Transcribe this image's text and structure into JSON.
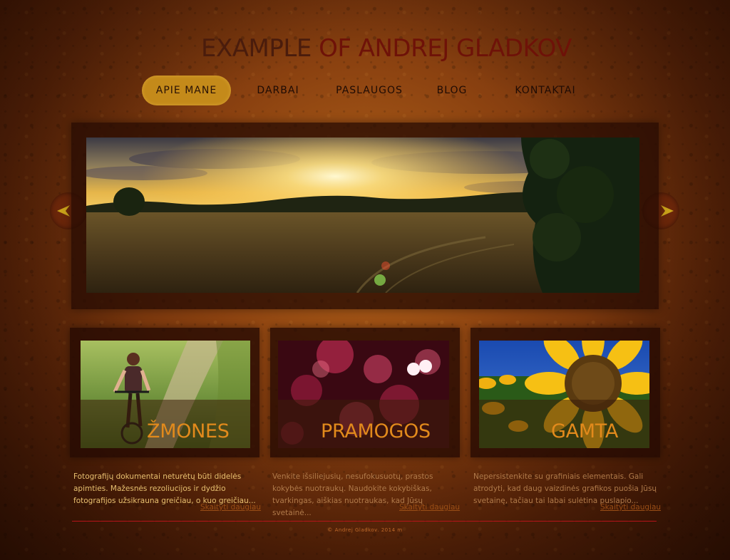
{
  "header": {
    "title_part1": "EXAMPLE",
    "title_part2": "OF ANDREJ GLADKOV"
  },
  "nav": {
    "items": [
      {
        "label": "APIE MANE",
        "active": true
      },
      {
        "label": "DARBAI",
        "active": false
      },
      {
        "label": "PASLAUGOS",
        "active": false
      },
      {
        "label": "BLOG",
        "active": false
      },
      {
        "label": "KONTAKTAI",
        "active": false
      }
    ]
  },
  "slider": {
    "image": "sunset-over-field-photo",
    "prev_icon": "chevron-left-icon",
    "next_icon": "chevron-right-icon"
  },
  "cards": [
    {
      "label": "ŽMONES",
      "image": "woman-on-bicycle-photo",
      "text": "Fotografijų dokumentai neturėtų būti didelės apimties. Mažesnės rezoliucijos ir dydžio fotografijos užsikrauna greičiau, o kuo greičiau...",
      "read_more": "Skaityti daugiau"
    },
    {
      "label": "PRAMOGOS",
      "image": "bokeh-lights-photo",
      "text": "Venkite išsiliejusių, nesufokusuotų, prastos kokybės nuotraukų. Naudokite kokybiškas, tvarkingas, aiškias nuotraukas, kad Jūsų svetainė...",
      "read_more": "Skaityti daugiau"
    },
    {
      "label": "GAMTA",
      "image": "sunflower-photo",
      "text": "Nepersistenkite su grafiniais elementais. Gali atrodyti, kad daug vaizdinės grafikos puošia Jūsų svetainę, tačiau tai labai sulėtina puslapio...",
      "read_more": "Skaityti daugiau"
    }
  ],
  "footer": {
    "copyright": "© Andrej Gladkov. 2014 m"
  },
  "colors": {
    "accent": "#c48a1a",
    "card_label": "#e28a1c",
    "footer_rule": "#b8141a",
    "card_text_1": "#e8c070",
    "card_text_2": "#b07a4a"
  }
}
